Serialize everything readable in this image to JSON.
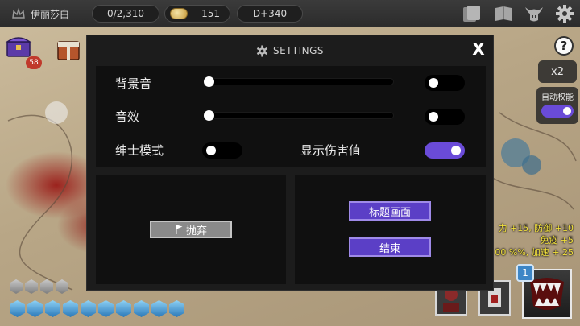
{
  "hud": {
    "player_name": "伊丽莎白",
    "stamina": "0/2,310",
    "gold": "151",
    "day": "D+340",
    "chest_count": "58"
  },
  "right_panel": {
    "help": "?",
    "speed": "x2",
    "auto_label": "自动权能",
    "auto_enabled": true,
    "ult_level": "1"
  },
  "stats_lines": [
    "力 +15, 防御 +10",
    "免疫 +5",
    "00 %%, 加速 +.25"
  ],
  "settings": {
    "title": "SETTINGS",
    "close": "X",
    "bgm_label": "背景音",
    "sfx_label": "音效",
    "gentleman_label": "绅士模式",
    "damage_label": "显示伤害值",
    "bgm_volume": 0,
    "sfx_volume": 0,
    "bgm_muted_toggle": false,
    "sfx_muted_toggle": false,
    "gentleman_mode": false,
    "show_damage": true,
    "abandon_label": "抛弃",
    "title_screen_label": "标题画面",
    "quit_label": "结束"
  },
  "colors": {
    "accent_purple": "#6a4bd8",
    "button_purple": "#5b3fc6",
    "dialog_bg": "#1c1c1c",
    "panel_bg": "#101010",
    "stat_text": "#f3e23c"
  },
  "icons": [
    "crown-icon",
    "coin-icon",
    "card-icon",
    "book-icon",
    "horned-helmet-icon",
    "gear-icon",
    "chest-icon",
    "flag-icon",
    "fang-mouth-icon"
  ]
}
